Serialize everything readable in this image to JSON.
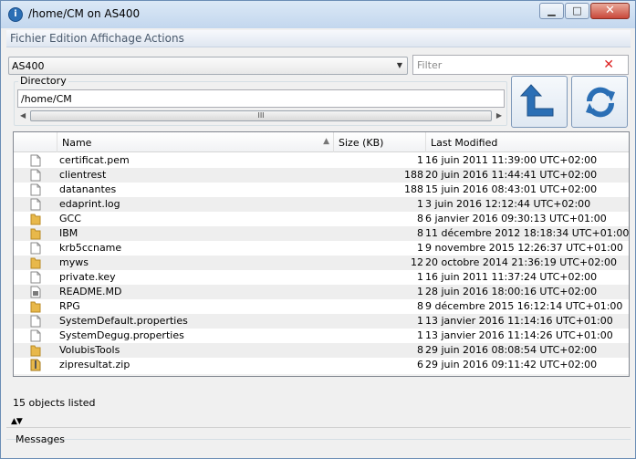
{
  "window": {
    "title": "/home/CM on AS400"
  },
  "menu": [
    "Fichier",
    "Edition",
    "Affichage",
    "Actions"
  ],
  "system_combo": {
    "value": "AS400"
  },
  "filter": {
    "placeholder": "Filter"
  },
  "directory": {
    "label": "Directory",
    "value": "/home/CM"
  },
  "list": {
    "columns": [
      "Name",
      "Size (KB)",
      "Last Modified"
    ],
    "rows": [
      {
        "name": "certificat.pem",
        "size": "1",
        "modified": "16 juin 2011 11:39:00 UTC+02:00",
        "icon": "file-icon"
      },
      {
        "name": "clientrest",
        "size": "188",
        "modified": "20 juin 2016 11:44:41 UTC+02:00",
        "icon": "file-icon"
      },
      {
        "name": "datanantes",
        "size": "188",
        "modified": "15 juin 2016 08:43:01 UTC+02:00",
        "icon": "file-icon"
      },
      {
        "name": "edaprint.log",
        "size": "1",
        "modified": "3 juin 2016 12:12:44 UTC+02:00",
        "icon": "file-icon"
      },
      {
        "name": "GCC",
        "size": "8",
        "modified": "6 janvier 2016 09:30:13 UTC+01:00",
        "icon": "folder-icon"
      },
      {
        "name": "IBM",
        "size": "8",
        "modified": "11 décembre 2012 18:18:34 UTC+01:00",
        "icon": "folder-icon"
      },
      {
        "name": "krb5ccname",
        "size": "1",
        "modified": "9 novembre 2015 12:26:37 UTC+01:00",
        "icon": "file-icon"
      },
      {
        "name": "myws",
        "size": "12",
        "modified": "20 octobre 2014 21:36:19 UTC+02:00",
        "icon": "folder-icon"
      },
      {
        "name": "private.key",
        "size": "1",
        "modified": "16 juin 2011 11:37:24 UTC+02:00",
        "icon": "file-icon"
      },
      {
        "name": "README.MD",
        "size": "1",
        "modified": "28 juin 2016 18:00:16 UTC+02:00",
        "icon": "text-file-icon"
      },
      {
        "name": "RPG",
        "size": "8",
        "modified": "9 décembre 2015 16:12:14 UTC+01:00",
        "icon": "folder-icon"
      },
      {
        "name": "SystemDefault.properties",
        "size": "1",
        "modified": "13 janvier 2016 11:14:16 UTC+01:00",
        "icon": "file-icon"
      },
      {
        "name": "SystemDegug.properties",
        "size": "1",
        "modified": "13 janvier 2016 11:14:26 UTC+01:00",
        "icon": "file-icon"
      },
      {
        "name": "VolubisTools",
        "size": "8",
        "modified": "29 juin 2016 08:08:54 UTC+02:00",
        "icon": "folder-icon"
      },
      {
        "name": "zipresultat.zip",
        "size": "6",
        "modified": "29 juin 2016 09:11:42 UTC+02:00",
        "icon": "zip-file-icon"
      }
    ]
  },
  "status": {
    "text": "15 objects listed"
  },
  "messages": {
    "label": "Messages"
  },
  "colors": {
    "accent": "#2b6fb5",
    "row_alt": "#eeeeee",
    "folder": "#e8b84a"
  }
}
